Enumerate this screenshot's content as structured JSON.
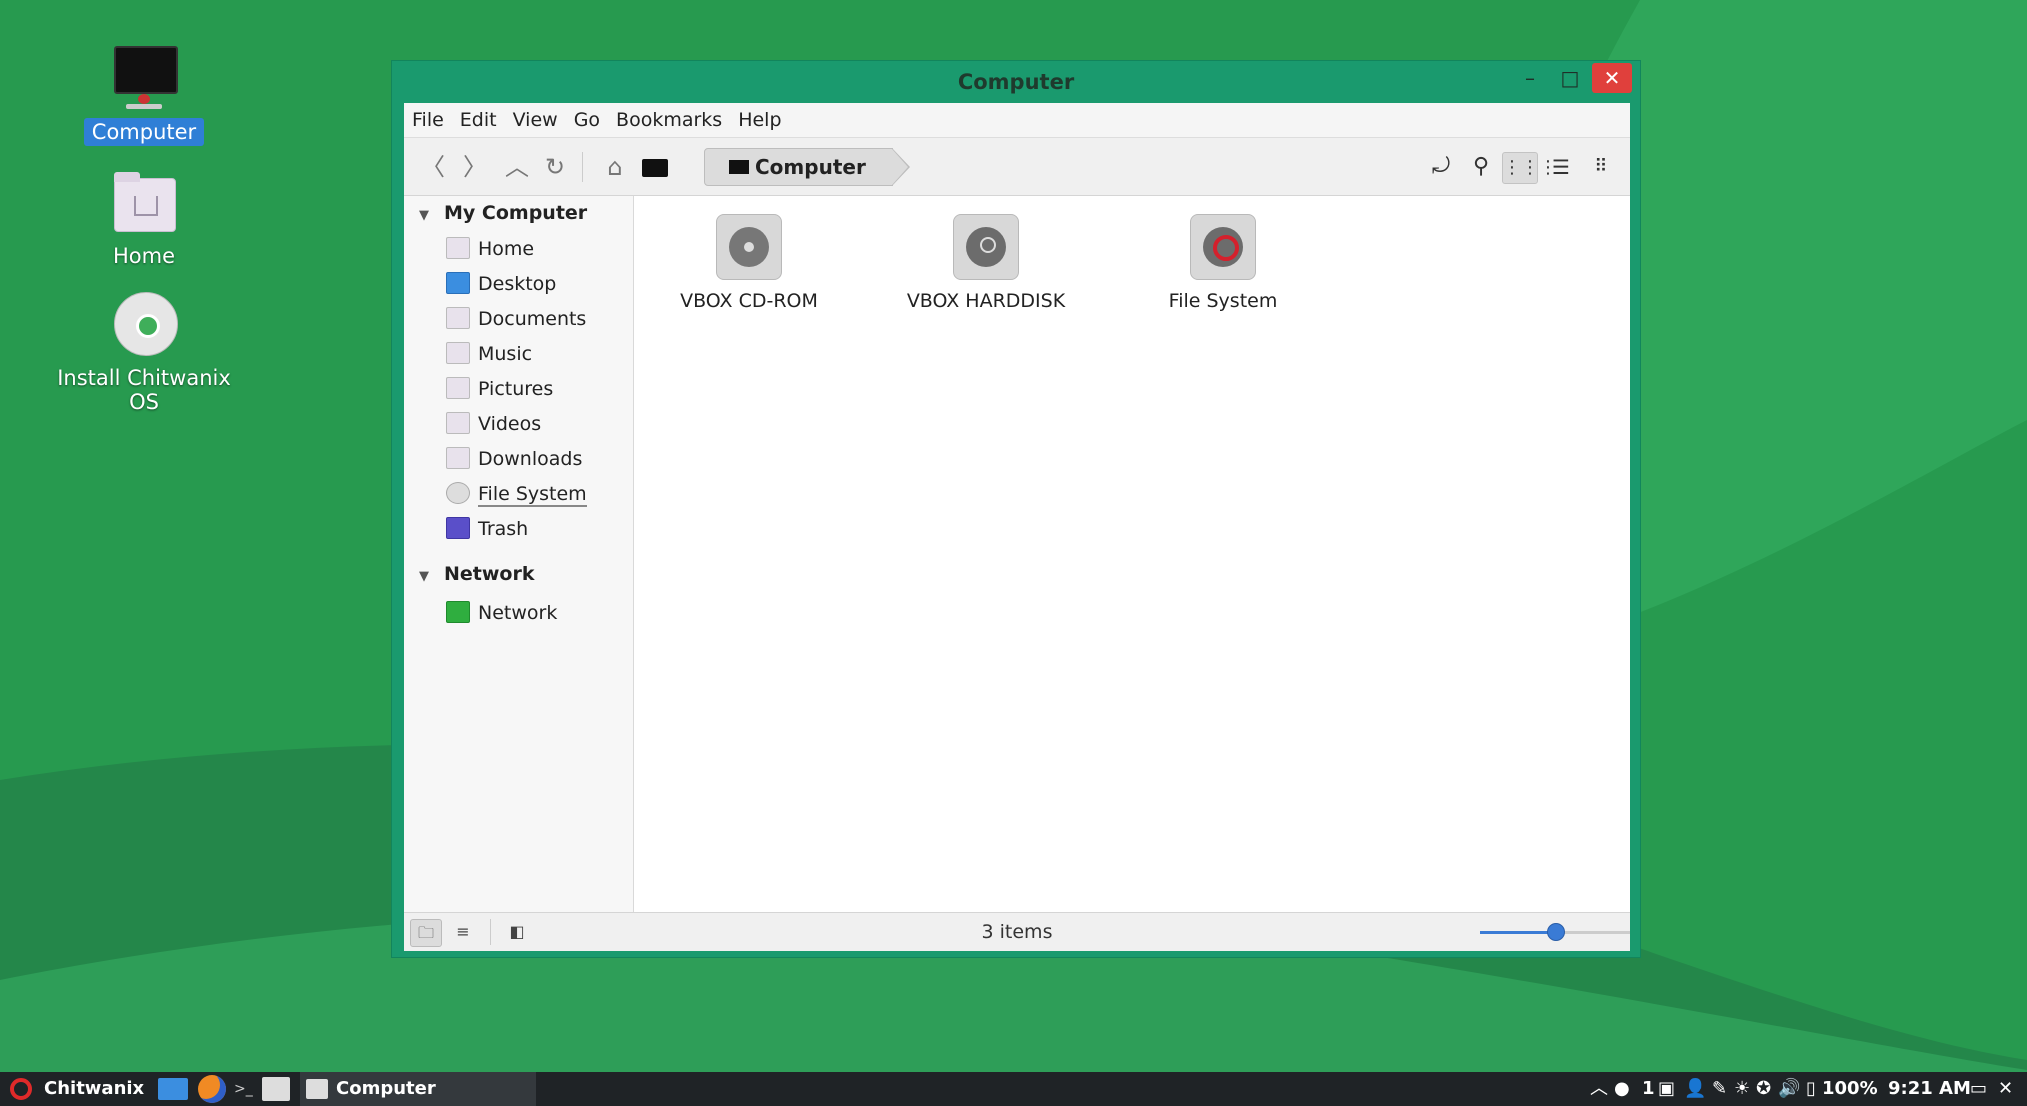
{
  "desktop": {
    "icons": [
      {
        "label": "Computer"
      },
      {
        "label": "Home"
      },
      {
        "label": "Install Chitwanix OS"
      }
    ]
  },
  "window": {
    "title": "Computer",
    "controls": {
      "minimize": "–",
      "maximize": "□",
      "close": "✕"
    },
    "menu": [
      "File",
      "Edit",
      "View",
      "Go",
      "Bookmarks",
      "Help"
    ],
    "breadcrumb": "Computer",
    "sidebar": {
      "sections": [
        {
          "title": "My Computer",
          "items": [
            "Home",
            "Desktop",
            "Documents",
            "Music",
            "Pictures",
            "Videos",
            "Downloads",
            "File System",
            "Trash"
          ]
        },
        {
          "title": "Network",
          "items": [
            "Network"
          ]
        }
      ]
    },
    "items": [
      {
        "label": "VBOX CD-ROM"
      },
      {
        "label": "VBOX HARDDISK"
      },
      {
        "label": "File System"
      }
    ],
    "status": "3 items",
    "zoom_level": 0.5
  },
  "taskbar": {
    "menu_label": "Chitwanix",
    "window_button": "Computer",
    "tray": {
      "workspace": "1",
      "battery": "100%",
      "clock": "9:21 AM"
    }
  },
  "colors": {
    "desktop_green": "#279a4f",
    "window_frame": "#1a9a6e",
    "close_button": "#e0403c",
    "accent": "#3a7bd5"
  }
}
